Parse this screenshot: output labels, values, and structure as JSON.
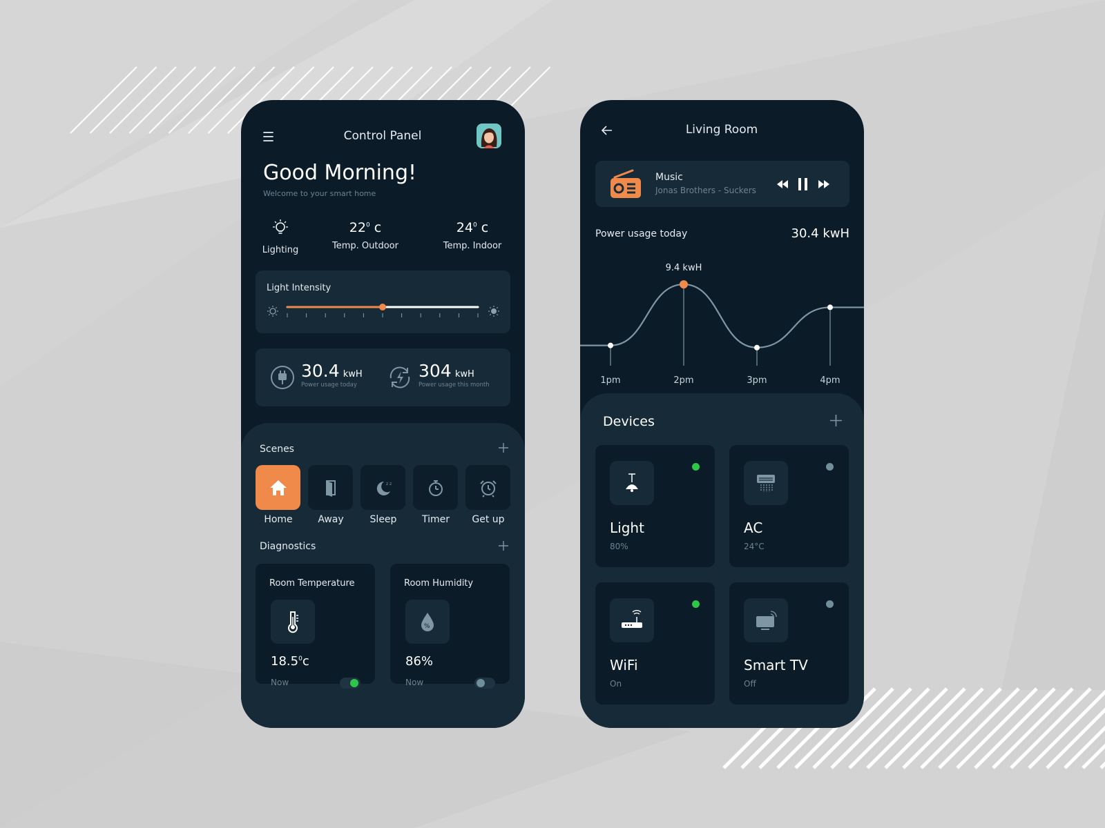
{
  "colors": {
    "accent": "#f08a4b",
    "phone_bg": "#0b1b27",
    "card_bg": "#172a37",
    "status_on": "#2ec548",
    "status_off": "#6f8f9a"
  },
  "control_panel": {
    "title": "Control Panel",
    "greeting": "Good Morning!",
    "subtitle": "Welcome to your smart home",
    "stats": [
      {
        "icon": "bulb-icon",
        "value": "",
        "label": "Lighting"
      },
      {
        "value": "22",
        "sup": "0",
        "unit": "c",
        "label": "Temp. Outdoor"
      },
      {
        "value": "24",
        "sup": "0",
        "unit": "c",
        "label": "Temp. Indoor"
      }
    ],
    "light_intensity": {
      "label": "Light Intensity",
      "level": 0.5
    },
    "power": [
      {
        "icon": "plug-icon",
        "value": "30.4",
        "unit": "kwH",
        "label": "Power usage today"
      },
      {
        "icon": "power-refresh-icon",
        "value": "304",
        "unit": "kwH",
        "label": "Power usage this month"
      }
    ],
    "scenes_title": "Scenes",
    "scenes": [
      {
        "label": "Home",
        "icon": "home-icon",
        "active": true
      },
      {
        "label": "Away",
        "icon": "door-icon",
        "active": false
      },
      {
        "label": "Sleep",
        "icon": "moon-icon",
        "active": false
      },
      {
        "label": "Timer",
        "icon": "stopwatch-icon",
        "active": false
      },
      {
        "label": "Get up",
        "icon": "alarm-clock-icon",
        "active": false
      }
    ],
    "diagnostics_title": "Diagnostics",
    "diagnostics": [
      {
        "title": "Room Temperature",
        "icon": "thermometer-icon",
        "value": "18.5",
        "sup": "0",
        "unit": "c",
        "time": "Now",
        "on": true
      },
      {
        "title": "Room Humidity",
        "icon": "humidity-drop-icon",
        "value": "86%",
        "sup": "",
        "unit": "",
        "time": "Now",
        "on": false
      }
    ]
  },
  "living_room": {
    "title": "Living Room",
    "music": {
      "title": "Music",
      "track": "Jonas Brothers - Suckers",
      "icon": "radio-icon"
    },
    "power_label": "Power usage today",
    "power_value": "30.4 kwH",
    "devices_title": "Devices",
    "devices": [
      {
        "name": "Light",
        "status": "80%",
        "icon": "ceiling-lamp-icon",
        "on": true
      },
      {
        "name": "AC",
        "status": "24°C",
        "icon": "air-conditioner-icon",
        "on": false
      },
      {
        "name": "WiFi",
        "status": "On",
        "icon": "router-icon",
        "on": true
      },
      {
        "name": "Smart TV",
        "status": "Off",
        "icon": "smart-tv-icon",
        "on": false
      }
    ]
  },
  "chart_data": {
    "type": "line",
    "title": "Power usage today",
    "x": [
      "1pm",
      "2pm",
      "3pm",
      "4pm"
    ],
    "series": [
      {
        "values": [
          0.9,
          9.4,
          0.6,
          6.2
        ]
      }
    ],
    "annotations": [
      {
        "x": "2pm",
        "label": "9.4 kwH"
      }
    ],
    "ylim": [
      0,
      12
    ],
    "grid": false
  }
}
